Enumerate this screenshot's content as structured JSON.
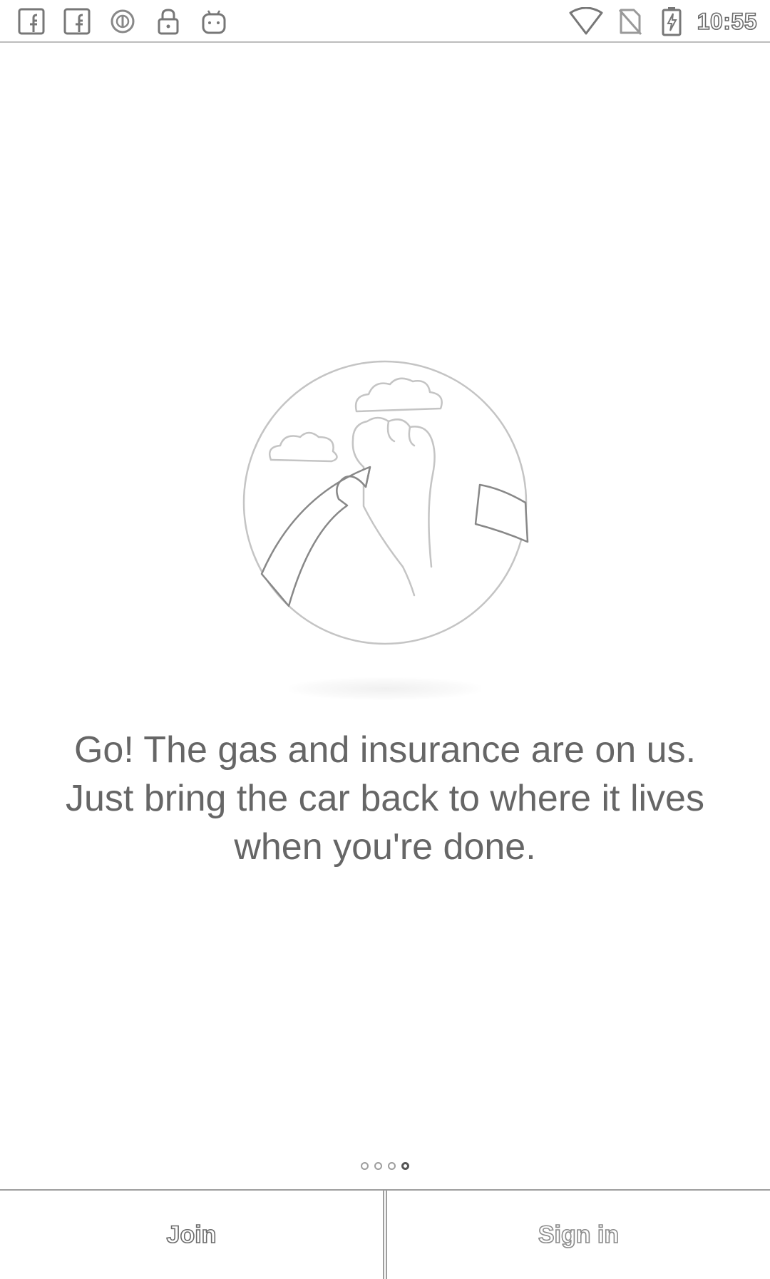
{
  "status_bar": {
    "time": "10:55",
    "left_icons": [
      "facebook-icon",
      "facebook-icon",
      "sync-icon",
      "lock-icon",
      "android-icon"
    ],
    "right_icons": [
      "wifi-icon",
      "no-sim-icon",
      "battery-charging-icon"
    ]
  },
  "onboarding": {
    "message": "Go! The gas and insurance are on us. Just bring the car back to where it lives when you're done.",
    "page_count": 4,
    "current_page": 4
  },
  "actions": {
    "join_label": "Join",
    "signin_label": "Sign in"
  },
  "colors": {
    "background": "#ffffff",
    "text": "#666666",
    "line": "#bdbdbd"
  }
}
